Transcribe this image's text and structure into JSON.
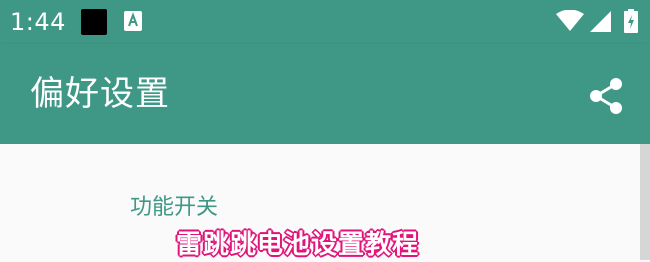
{
  "status_bar": {
    "time": "1:44",
    "notification_icons": [
      "black-square-icon",
      "keyboard-a-icon"
    ],
    "system_icons": [
      "wifi-icon",
      "signal-icon",
      "battery-icon"
    ]
  },
  "app_bar": {
    "title": "偏好设置",
    "action_icon": "share-icon"
  },
  "preferences": {
    "section_header": "功能开关"
  },
  "overlay": {
    "caption": "雷跳跳电池设置教程"
  },
  "colors": {
    "primary": "#3f9885",
    "caption_outline": "#e0157a",
    "background": "#fafafa"
  }
}
